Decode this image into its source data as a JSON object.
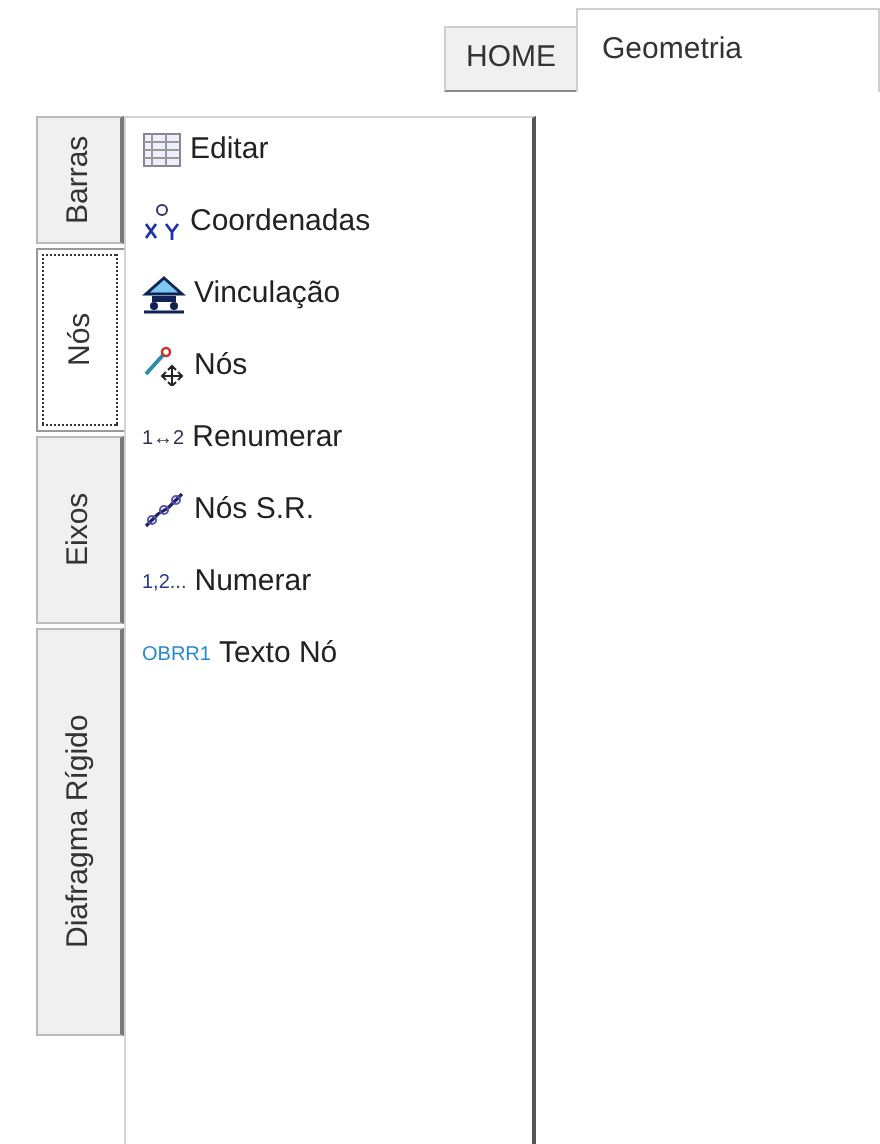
{
  "top_tabs": [
    {
      "label": "HOME",
      "selected": false
    },
    {
      "label": "Geometria",
      "selected": true
    }
  ],
  "side_tabs": [
    {
      "label": "Barras",
      "selected": false
    },
    {
      "label": "Nós",
      "selected": true
    },
    {
      "label": "Eixos",
      "selected": false
    },
    {
      "label": "Diafragma Rígido",
      "selected": false
    }
  ],
  "commands": [
    {
      "label": "Editar",
      "kind": "table"
    },
    {
      "label": "Coordenadas",
      "kind": "xy"
    },
    {
      "label": "Vinculação",
      "kind": "support"
    },
    {
      "label": "Nós",
      "kind": "node-move"
    },
    {
      "label": "Renumerar",
      "kind": "text-icon",
      "icon_text": "1↔2"
    },
    {
      "label": "Nós S.R.",
      "kind": "chain"
    },
    {
      "label": "Numerar",
      "kind": "text-icon",
      "icon_text": "1,2..."
    },
    {
      "label": "Texto Nó",
      "kind": "text-icon",
      "icon_text": "OBRR1"
    }
  ]
}
